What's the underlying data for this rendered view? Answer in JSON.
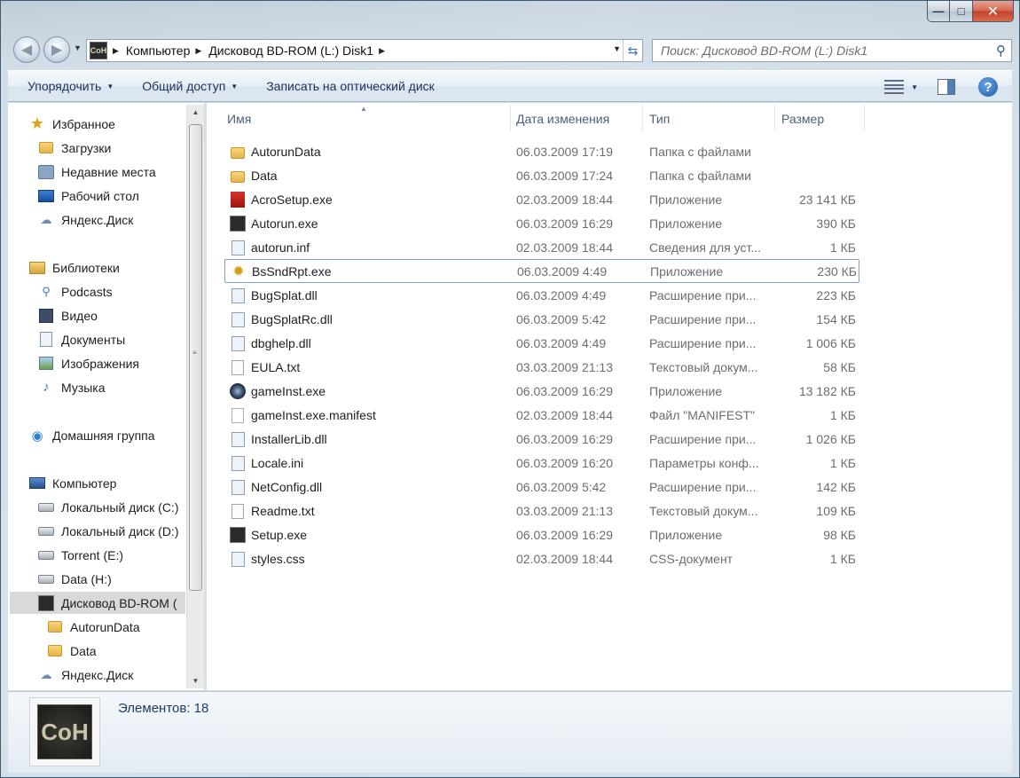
{
  "window": {
    "min_label": "—",
    "max_label": "□",
    "close_label": "✕"
  },
  "address": {
    "app_icon_label": "CoH",
    "crumbs": [
      "Компьютер",
      "Дисковод BD-ROM (L:) Disk1"
    ]
  },
  "search": {
    "placeholder": "Поиск: Дисковод BD-ROM (L:) Disk1"
  },
  "toolbar": {
    "organize": "Упорядочить",
    "share": "Общий доступ",
    "burn": "Записать на оптический диск",
    "help": "?"
  },
  "navpane": {
    "items": [
      {
        "label": "Избранное",
        "icon": "star-icon"
      },
      {
        "label": "Загрузки",
        "icon": "downloads-folder-icon"
      },
      {
        "label": "Недавние места",
        "icon": "recent-places-icon"
      },
      {
        "label": "Рабочий стол",
        "icon": "desktop-icon"
      },
      {
        "label": "Яндекс.Диск",
        "icon": "yandex-disk-icon"
      },
      {
        "label": "Библиотеки",
        "icon": "libraries-icon"
      },
      {
        "label": "Podcasts",
        "icon": "podcasts-icon"
      },
      {
        "label": "Видео",
        "icon": "video-library-icon"
      },
      {
        "label": "Документы",
        "icon": "documents-library-icon"
      },
      {
        "label": "Изображения",
        "icon": "pictures-library-icon"
      },
      {
        "label": "Музыка",
        "icon": "music-library-icon"
      },
      {
        "label": "Домашняя группа",
        "icon": "homegroup-icon"
      },
      {
        "label": "Компьютер",
        "icon": "computer-icon"
      },
      {
        "label": "Локальный диск (C:)",
        "icon": "local-disk-c-icon"
      },
      {
        "label": "Локальный диск (D:)",
        "icon": "local-disk-d-icon"
      },
      {
        "label": "Torrent (E:)",
        "icon": "disk-e-icon"
      },
      {
        "label": "Data (H:)",
        "icon": "disk-h-icon"
      },
      {
        "label": "Дисковод BD-ROM (",
        "icon": "bd-rom-drive-icon"
      },
      {
        "label": "AutorunData",
        "icon": "folder-icon"
      },
      {
        "label": "Data",
        "icon": "folder-icon"
      },
      {
        "label": "Яндекс.Диск",
        "icon": "yandex-disk-icon"
      }
    ]
  },
  "columns": {
    "name": "Имя",
    "date": "Дата изменения",
    "type": "Тип",
    "size": "Размер"
  },
  "files": [
    {
      "name": "AutorunData",
      "date": "06.03.2009 17:19",
      "type": "Папка с файлами",
      "size": "",
      "icon": "folder-icon"
    },
    {
      "name": "Data",
      "date": "06.03.2009 17:24",
      "type": "Папка с файлами",
      "size": "",
      "icon": "folder-icon"
    },
    {
      "name": "AcroSetup.exe",
      "date": "02.03.2009 18:44",
      "type": "Приложение",
      "size": "23 141 КБ",
      "icon": "acrobat-installer-icon"
    },
    {
      "name": "Autorun.exe",
      "date": "06.03.2009 16:29",
      "type": "Приложение",
      "size": "390 КБ",
      "icon": "coh-app-icon"
    },
    {
      "name": "autorun.inf",
      "date": "02.03.2009 18:44",
      "type": "Сведения для уст...",
      "size": "1 КБ",
      "icon": "settings-file-icon"
    },
    {
      "name": "BsSndRpt.exe",
      "date": "06.03.2009 4:49",
      "type": "Приложение",
      "size": "230 КБ",
      "icon": "bug-report-icon"
    },
    {
      "name": "BugSplat.dll",
      "date": "06.03.2009 4:49",
      "type": "Расширение при...",
      "size": "223 КБ",
      "icon": "dll-file-icon"
    },
    {
      "name": "BugSplatRc.dll",
      "date": "06.03.2009 5:42",
      "type": "Расширение при...",
      "size": "154 КБ",
      "icon": "dll-file-icon"
    },
    {
      "name": "dbghelp.dll",
      "date": "06.03.2009 4:49",
      "type": "Расширение при...",
      "size": "1 006 КБ",
      "icon": "dll-file-icon"
    },
    {
      "name": "EULA.txt",
      "date": "03.03.2009 21:13",
      "type": "Текстовый докум...",
      "size": "58 КБ",
      "icon": "text-file-icon"
    },
    {
      "name": "gameInst.exe",
      "date": "06.03.2009 16:29",
      "type": "Приложение",
      "size": "13 182 КБ",
      "icon": "game-installer-icon"
    },
    {
      "name": "gameInst.exe.manifest",
      "date": "02.03.2009 18:44",
      "type": "Файл \"MANIFEST\"",
      "size": "1 КБ",
      "icon": "blank-file-icon"
    },
    {
      "name": "InstallerLib.dll",
      "date": "06.03.2009 16:29",
      "type": "Расширение при...",
      "size": "1 026 КБ",
      "icon": "dll-file-icon"
    },
    {
      "name": "Locale.ini",
      "date": "06.03.2009 16:20",
      "type": "Параметры конф...",
      "size": "1 КБ",
      "icon": "settings-file-icon"
    },
    {
      "name": "NetConfig.dll",
      "date": "06.03.2009 5:42",
      "type": "Расширение при...",
      "size": "142 КБ",
      "icon": "dll-file-icon"
    },
    {
      "name": "Readme.txt",
      "date": "03.03.2009 21:13",
      "type": "Текстовый докум...",
      "size": "109 КБ",
      "icon": "text-file-icon"
    },
    {
      "name": "Setup.exe",
      "date": "06.03.2009 16:29",
      "type": "Приложение",
      "size": "98 КБ",
      "icon": "coh-app-icon"
    },
    {
      "name": "styles.css",
      "date": "02.03.2009 18:44",
      "type": "CSS-документ",
      "size": "1 КБ",
      "icon": "settings-file-icon"
    }
  ],
  "details": {
    "count_text": "Элементов: 18",
    "thumb_label": "CoH"
  }
}
